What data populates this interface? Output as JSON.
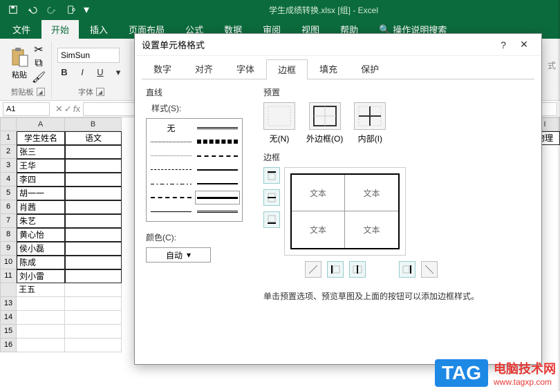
{
  "app": {
    "title": "学生成绩转换.xlsx [组] - Excel"
  },
  "ribbon": {
    "tabs": [
      "文件",
      "开始",
      "插入",
      "页面布局",
      "公式",
      "数据",
      "审阅",
      "视图",
      "帮助"
    ],
    "tell_me": "操作说明搜索",
    "active": 1,
    "clipboard": {
      "label": "剪贴板",
      "paste": "粘贴"
    },
    "font": {
      "label": "字体",
      "name": "SimSun",
      "bold": "B",
      "italic": "I",
      "underline": "U"
    },
    "styles_hint": "式"
  },
  "namebox": "A1",
  "columns": [
    "A",
    "B",
    "I"
  ],
  "header_row": {
    "a": "学生姓名",
    "b": "语文",
    "i": "物理"
  },
  "rows": [
    {
      "n": "1"
    },
    {
      "n": "2",
      "a": "张三"
    },
    {
      "n": "3",
      "a": "王华"
    },
    {
      "n": "4",
      "a": "李四"
    },
    {
      "n": "5",
      "a": "胡一一"
    },
    {
      "n": "6",
      "a": "肖茜"
    },
    {
      "n": "7",
      "a": "朱艺"
    },
    {
      "n": "8",
      "a": "黄心怡"
    },
    {
      "n": "9",
      "a": "侯小磊"
    },
    {
      "n": "10",
      "a": "陈成"
    },
    {
      "n": "11",
      "a": "刘小雷"
    },
    {
      "n": "",
      "a": "王五"
    },
    {
      "n": "13"
    },
    {
      "n": "14"
    },
    {
      "n": "15"
    },
    {
      "n": "16"
    }
  ],
  "dialog": {
    "title": "设置单元格格式",
    "help": "?",
    "tabs": [
      "数字",
      "对齐",
      "字体",
      "边框",
      "填充",
      "保护"
    ],
    "active": 3,
    "line_section": "直线",
    "style_label": "样式(S):",
    "none": "无",
    "color_label": "颜色(C):",
    "color_auto": "自动",
    "preset_section": "预置",
    "presets": {
      "none": "无(N)",
      "outline": "外边框(O)",
      "inside": "内部(I)"
    },
    "border_section": "边框",
    "preview_text": "文本",
    "hint": "单击预置选项、预览草图及上面的按钮可以添加边框样式。"
  },
  "watermark": {
    "tag": "TAG",
    "cn": "电脑技术网",
    "url": "www.tagxp.com"
  }
}
